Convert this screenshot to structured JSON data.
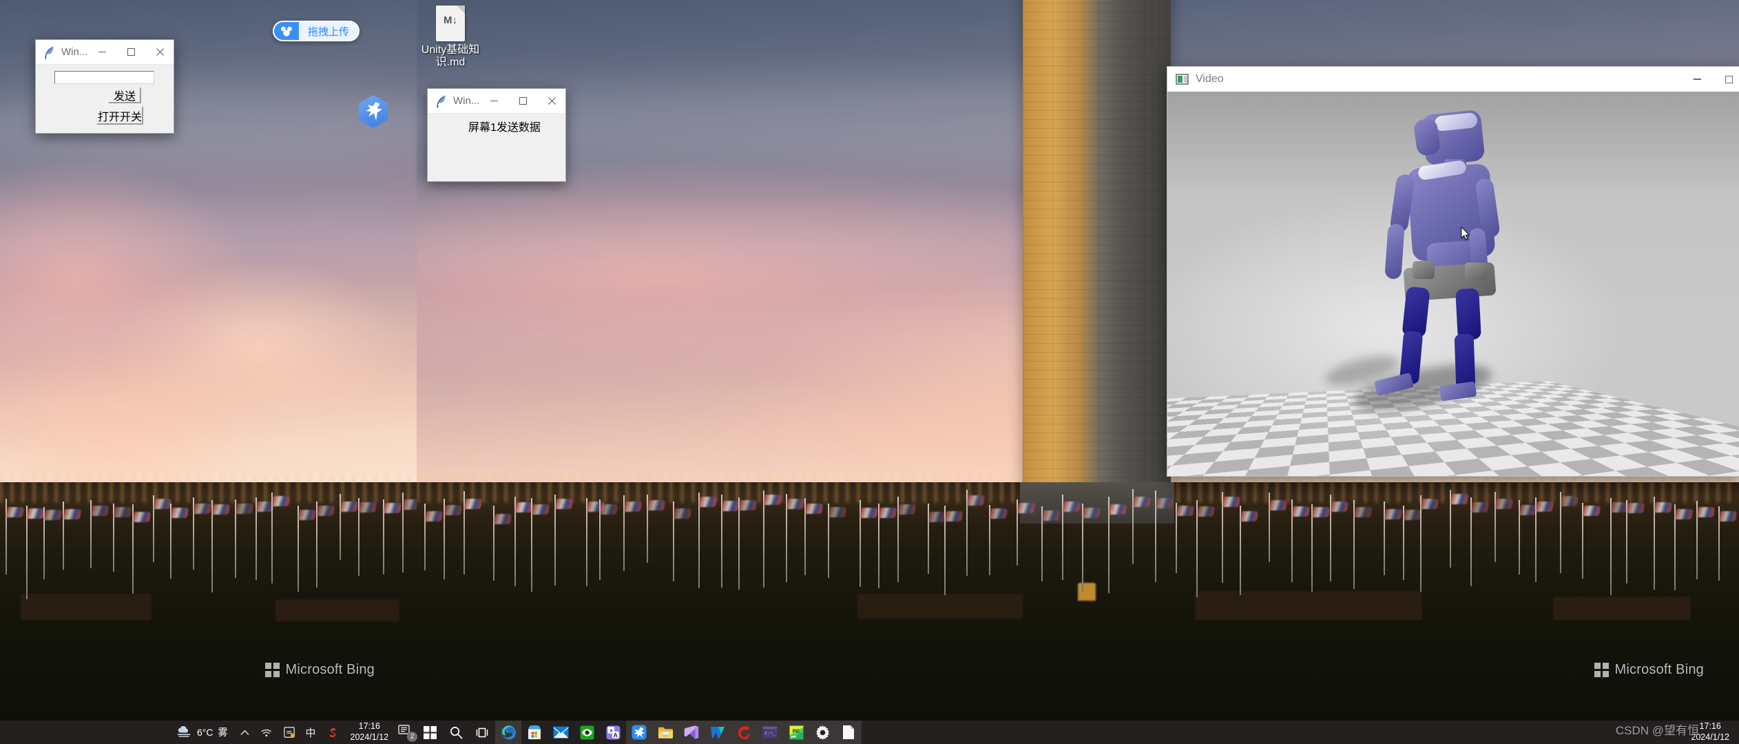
{
  "desktop": {
    "icons": [
      {
        "name": "markdown-file",
        "label": "Unity基础知识.md",
        "glyph": "M↓"
      },
      {
        "name": "xunlei-shortcut",
        "label": ""
      }
    ],
    "netdisk_widget": {
      "label": "拖拽上传",
      "icon": "baidu-netdisk-icon"
    },
    "wallpaper_watermark": "Microsoft Bing"
  },
  "windows": {
    "tk1": {
      "title": "Win...",
      "icon": "tkinter-feather-icon",
      "entry_value": "",
      "entry_placeholder": "",
      "send_button": "发送",
      "switch_button": "打开开关",
      "controls": {
        "minimize": "—",
        "maximize": "☐",
        "close": "✕"
      }
    },
    "tk2": {
      "title": "Win...",
      "icon": "tkinter-feather-icon",
      "message": "屏幕1发送数据",
      "controls": {
        "minimize": "—",
        "maximize": "☐",
        "close": "✕"
      }
    },
    "video": {
      "title": "Video",
      "icon": "video-window-icon",
      "controls": {
        "minimize": "—",
        "maximize": "☐"
      },
      "scene": "humanoid-robot-simulation"
    }
  },
  "taskbar": {
    "weather": {
      "temperature": "6°C",
      "condition": "雾",
      "icon": "fog-cloud-icon"
    },
    "tray": [
      {
        "name": "show-hidden-icons",
        "glyph": "∧"
      },
      {
        "name": "network-wifi-icon",
        "glyph": ""
      },
      {
        "name": "onedrive-sync-icon",
        "glyph": ""
      },
      {
        "name": "ime-chinese-icon",
        "glyph": "中"
      },
      {
        "name": "sogou-input-icon",
        "glyph": "S"
      }
    ],
    "clock": {
      "time": "17:16",
      "date": "2024/1/12"
    },
    "notification_count": "2",
    "apps": [
      {
        "name": "start-button",
        "icon": "windows-logo-icon",
        "active": false
      },
      {
        "name": "search-button",
        "icon": "search-icon",
        "active": false
      },
      {
        "name": "task-view-button",
        "icon": "task-view-icon",
        "active": false
      },
      {
        "name": "edge-browser",
        "icon": "edge-icon",
        "active": true
      },
      {
        "name": "microsoft-store",
        "icon": "store-icon",
        "active": false
      },
      {
        "name": "mail-app",
        "icon": "mail-icon",
        "active": false
      },
      {
        "name": "eye-care-app",
        "icon": "green-eye-icon",
        "active": false
      },
      {
        "name": "translate-app",
        "icon": "translate-icon",
        "active": false
      },
      {
        "name": "xunlei-app",
        "icon": "xunlei-bird-icon",
        "active": true
      },
      {
        "name": "file-explorer",
        "icon": "folder-icon",
        "active": true
      },
      {
        "name": "visual-studio",
        "icon": "visual-studio-icon",
        "active": true
      },
      {
        "name": "wps-app",
        "icon": "wps-icon",
        "active": true
      },
      {
        "name": "gitee-app",
        "icon": "red-g-icon",
        "active": true
      },
      {
        "name": "terminal-app",
        "icon": "terminal-icon",
        "active": true
      },
      {
        "name": "pycharm-app",
        "icon": "pycharm-icon",
        "active": true
      },
      {
        "name": "settings-app",
        "icon": "gear-icon",
        "active": true
      },
      {
        "name": "notepad-app",
        "icon": "document-icon",
        "active": true
      }
    ],
    "clock_right": {
      "time": "17:16",
      "date": "2024/1/12"
    },
    "watermark": "CSDN @望有恒"
  },
  "colors": {
    "accent": "#5ea8e8",
    "taskbar_bg": "#242020",
    "window_bg": "#f0f0f0",
    "robot_body": "#4f4d96",
    "robot_legs": "#16127a",
    "netdisk_blue": "#3a8ff7"
  }
}
